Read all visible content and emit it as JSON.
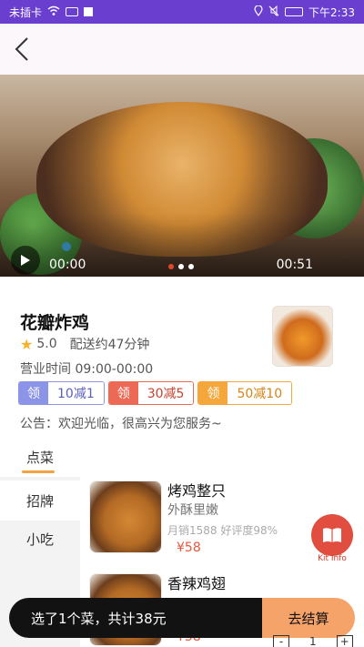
{
  "status_bar": {
    "carrier": "未插卡",
    "time": "下午2:33",
    "icons": [
      "wifi-icon",
      "sim-icon",
      "location-icon",
      "mute-icon",
      "battery-icon"
    ]
  },
  "nav": {
    "back_icon": "chevron-left-icon"
  },
  "hero_video": {
    "time_current": "00:00",
    "time_total": "00:51",
    "slide_count": 3,
    "active_slide": 0,
    "play_icon": "play-icon"
  },
  "shop": {
    "name": "花瓣炸鸡",
    "rating": "5.0",
    "delivery": "配送约47分钟",
    "hours": "营业时间 09:00-00:00",
    "coupons": [
      {
        "tag": "领",
        "value": "10减1",
        "color": "#8b94e6"
      },
      {
        "tag": "领",
        "value": "30减5",
        "color": "#ec6a55"
      },
      {
        "tag": "领",
        "value": "50减10",
        "color": "#f5a73b"
      }
    ],
    "notice": "公告：欢迎光临，很高兴为您服务~"
  },
  "menu": {
    "tab": "点菜",
    "categories": [
      "招牌",
      "小吃"
    ],
    "items": [
      {
        "title": "烤鸡整只",
        "desc": "外酥里嫩",
        "stats": "月销1588 好评度98%",
        "price": "¥58"
      },
      {
        "title": "香辣鸡翅",
        "desc": "",
        "stats": "",
        "price": "¥38"
      }
    ]
  },
  "kit": {
    "label": "Kit Info",
    "icon": "book-icon"
  },
  "cart": {
    "summary": "选了1个菜，共计38元",
    "checkout": "去结算",
    "qty": "1"
  },
  "colors": {
    "status_bar": "#6a3fd0",
    "accent": "#f4a340",
    "price": "#e5563b",
    "kit": "#e14d3f"
  }
}
